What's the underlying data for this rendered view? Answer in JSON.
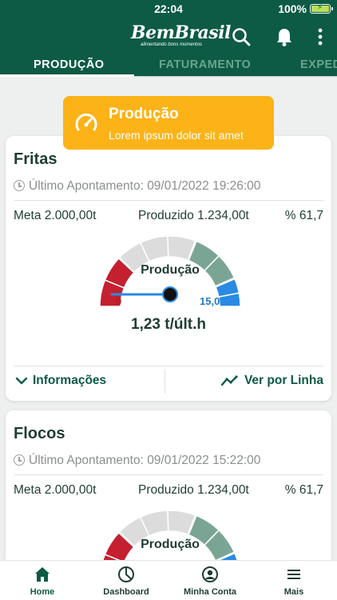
{
  "status_bar": {
    "time": "22:04",
    "battery": "100%"
  },
  "app_bar": {
    "brand_name": "BemBrasil",
    "brand_tagline": "alimentando bons momentos"
  },
  "tabs": [
    {
      "label": "PRODUÇÃO",
      "active": true
    },
    {
      "label": "FATURAMENTO",
      "active": false
    },
    {
      "label": "EXPEDIÇÃO",
      "active": false
    }
  ],
  "toast": {
    "title": "Produção",
    "subtitle": "Lorem ipsum dolor sit amet",
    "icon": "speedometer-icon"
  },
  "cards": [
    {
      "title": "Fritas",
      "last_update": "Último Apontamento: 09/01/2022 19:26:00",
      "meta": "Meta 2.000,00t",
      "produced": "Produzido 1.234,00t",
      "percent": "% 61,7",
      "gauge_label": "Produção",
      "gauge_min": "0",
      "gauge_max": "15,0",
      "gauge_value": 1.23,
      "rate": "1,23 t/últ.h",
      "info_label": "Informações",
      "line_label": "Ver por Linha"
    },
    {
      "title": "Flocos",
      "last_update": "Último Apontamento: 09/01/2022 15:22:00",
      "meta": "Meta 2.000,00t",
      "produced": "Produzido 1.234,00t",
      "percent": "% 61,7",
      "gauge_label": "Produção"
    }
  ],
  "bottom_nav": [
    {
      "label": "Home",
      "icon": "home-icon",
      "active": true
    },
    {
      "label": "Dashboard",
      "icon": "pie-chart-icon",
      "active": false
    },
    {
      "label": "Minha Conta",
      "icon": "user-circle-icon",
      "active": false
    },
    {
      "label": "Mais",
      "icon": "menu-icon",
      "active": false
    }
  ],
  "colors": {
    "brand": "#0d5a45",
    "toast": "#fbb318",
    "gauge_red": "#c4202f",
    "gauge_gray": "#dcdcdc",
    "gauge_green": "#7aa595",
    "gauge_blue": "#2a8ae4"
  }
}
